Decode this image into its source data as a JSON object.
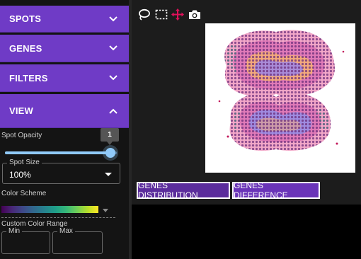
{
  "accordion": {
    "spots": "SPOTS",
    "genes": "GENES",
    "filters": "FILTERS",
    "view": "VIEW"
  },
  "view_panel": {
    "spot_opacity_label": "Spot Opacity",
    "spot_opacity_value": "1",
    "spot_opacity_fraction": 1,
    "spot_size_label": "Spot Size",
    "spot_size_value": "100%",
    "color_scheme_label": "Color Scheme",
    "color_scheme_colors": [
      "#440154",
      "#3e4989",
      "#26828e",
      "#35b779",
      "#fde725"
    ],
    "custom_range_label": "Custom Color Range",
    "min_label": "Min",
    "max_label": "Max"
  },
  "toolbar": {
    "icons": [
      "lasso-icon",
      "box-select-icon",
      "move-icon",
      "camera-icon"
    ],
    "active_color": "#e0105a"
  },
  "buttons": {
    "genes_distribution": "GENES DISTRIBUTION",
    "genes_difference": "GENES DIFFERENCE"
  },
  "colors": {
    "accent": "#6f3bc6",
    "slider": "#90caf9"
  }
}
